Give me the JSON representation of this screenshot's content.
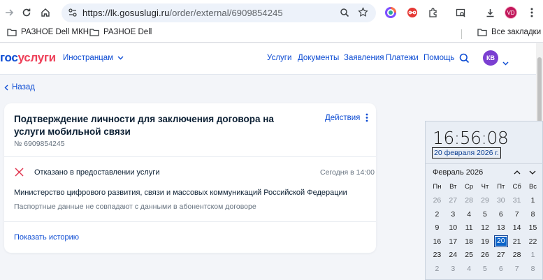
{
  "browser": {
    "url_host": "https://lk.gosuslugi.ru",
    "url_path": "/order/external/6909854245",
    "profile_initials": "VD",
    "bookmarks": [
      {
        "label": "РАЗНОЕ Dell МКН",
        "icon": "folder-icon"
      },
      {
        "label": "РАЗНОЕ Dell",
        "icon": "folder-icon"
      }
    ],
    "all_bookmarks_label": "Все закладки"
  },
  "site": {
    "logo_part1": "гос",
    "logo_part2": "услуги",
    "foreign_label": "Иностранцам",
    "nav": [
      "Услуги",
      "Документы",
      "Заявления",
      "Платежи",
      "Помощь"
    ],
    "user_initials": "КВ",
    "accent": "#0d4cd3",
    "brand_red": "#ee3f58"
  },
  "page": {
    "back_label": "Назад",
    "card": {
      "title": "Подтверждение личности для заключения договора на услуги мобильной связи",
      "actions_label": "Действия",
      "order_number": "№ 6909854245",
      "status": "Отказано в предоставлении услуги",
      "status_time": "Сегодня в 14:00",
      "status_color": "#e0364f",
      "ministry": "Министерство цифрового развития, связи и массовых коммуникаций Российской Федерации",
      "reason": "Паспортные данные не совпадают с данными в абонентском договоре",
      "history_label": "Показать историю"
    }
  },
  "clock": {
    "time": "16:56:08",
    "date": "20 февраля 2026 г.",
    "month_label": "Февраль 2026",
    "weekdays": [
      "Пн",
      "Вт",
      "Ср",
      "Чт",
      "Пт",
      "Сб",
      "Вс"
    ],
    "weeks": [
      [
        "26",
        "27",
        "28",
        "29",
        "30",
        "31",
        "1"
      ],
      [
        "2",
        "3",
        "4",
        "5",
        "6",
        "7",
        "8"
      ],
      [
        "9",
        "10",
        "11",
        "12",
        "13",
        "14",
        "15"
      ],
      [
        "16",
        "17",
        "18",
        "19",
        "20",
        "21",
        "22"
      ],
      [
        "23",
        "24",
        "25",
        "26",
        "27",
        "28",
        "1"
      ],
      [
        "2",
        "3",
        "4",
        "5",
        "6",
        "7",
        "8"
      ]
    ],
    "today": "20"
  }
}
